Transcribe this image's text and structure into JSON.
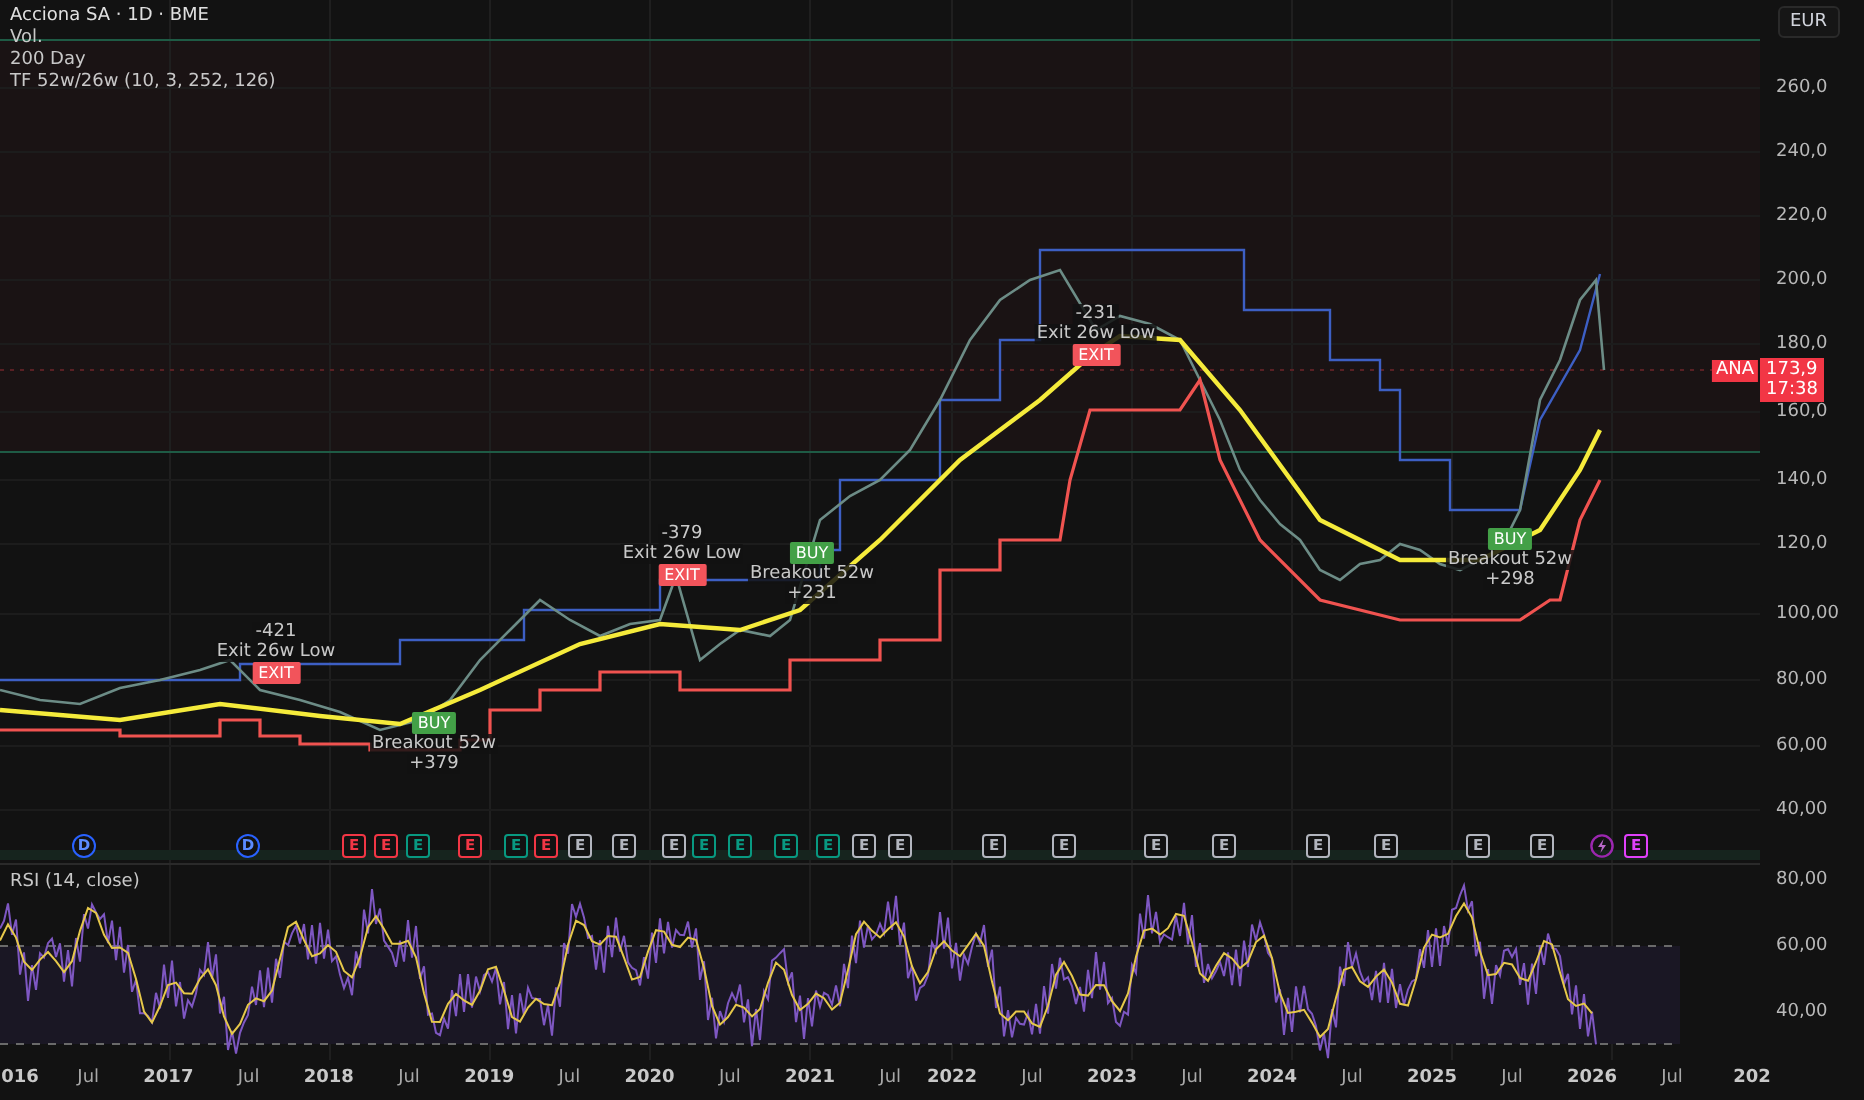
{
  "legend": {
    "symbol": "Acciona SA · 1D · BME",
    "indicators": [
      "Vol.",
      "200 Day",
      "TF 52w/26w (10, 3, 252, 126)"
    ]
  },
  "currency": "EUR",
  "price_axis": [
    "260,0",
    "240,0",
    "220,0",
    "200,0",
    "180,0",
    "160,0",
    "140,0",
    "120,0",
    "100,00",
    "80,00",
    "60,00",
    "40,00"
  ],
  "last_price": {
    "ticker": "ANA",
    "price": "173,9",
    "countdown": "17:38"
  },
  "signals": [
    {
      "kind": "exit",
      "badge": "EXIT",
      "label": "Exit 26w Low",
      "result": "-421"
    },
    {
      "kind": "buy",
      "badge": "BUY",
      "label": "Breakout 52w",
      "result": "+379"
    },
    {
      "kind": "exit",
      "badge": "EXIT",
      "label": "Exit 26w Low",
      "result": "-379"
    },
    {
      "kind": "buy",
      "badge": "BUY",
      "label": "Breakout 52w",
      "result": "+231"
    },
    {
      "kind": "exit",
      "badge": "EXIT",
      "label": "Exit 26w Low",
      "result": "-231"
    },
    {
      "kind": "buy",
      "badge": "BUY",
      "label": "Breakout 52w",
      "result": "+298"
    }
  ],
  "events": [
    {
      "kind": "dividend",
      "text": "D"
    },
    {
      "kind": "dividend",
      "text": "D"
    },
    {
      "kind": "earnings",
      "text": "E",
      "color": "#f23645"
    },
    {
      "kind": "earnings",
      "text": "E",
      "color": "#f23645"
    },
    {
      "kind": "earnings",
      "text": "E",
      "color": "#089981"
    },
    {
      "kind": "earnings",
      "text": "E",
      "color": "#f23645"
    },
    {
      "kind": "earnings",
      "text": "E",
      "color": "#089981"
    },
    {
      "kind": "earnings",
      "text": "E",
      "color": "#f23645"
    },
    {
      "kind": "earnings",
      "text": "E",
      "color": "#b2b5be"
    },
    {
      "kind": "earnings",
      "text": "E",
      "color": "#b2b5be"
    },
    {
      "kind": "earnings",
      "text": "E",
      "color": "#b2b5be"
    },
    {
      "kind": "earnings",
      "text": "E",
      "color": "#089981"
    },
    {
      "kind": "earnings",
      "text": "E",
      "color": "#089981"
    },
    {
      "kind": "earnings",
      "text": "E",
      "color": "#089981"
    },
    {
      "kind": "earnings",
      "text": "E",
      "color": "#089981"
    },
    {
      "kind": "earnings",
      "text": "E",
      "color": "#b2b5be"
    },
    {
      "kind": "earnings",
      "text": "E",
      "color": "#b2b5be"
    },
    {
      "kind": "earnings",
      "text": "E",
      "color": "#b2b5be"
    },
    {
      "kind": "earnings",
      "text": "E",
      "color": "#b2b5be"
    },
    {
      "kind": "earnings",
      "text": "E",
      "color": "#b2b5be"
    },
    {
      "kind": "earnings",
      "text": "E",
      "color": "#b2b5be"
    },
    {
      "kind": "earnings",
      "text": "E",
      "color": "#b2b5be"
    },
    {
      "kind": "earnings",
      "text": "E",
      "color": "#b2b5be"
    },
    {
      "kind": "earnings",
      "text": "E",
      "color": "#b2b5be"
    },
    {
      "kind": "earnings",
      "text": "E",
      "color": "#b2b5be"
    },
    {
      "kind": "split"
    },
    {
      "kind": "earnings",
      "text": "E",
      "color": "#e040fb"
    }
  ],
  "rsi": {
    "title": "RSI (14, close)",
    "axis": [
      "80,00",
      "60,00",
      "40,00"
    ]
  },
  "time_axis": [
    {
      "label": "016",
      "kind": "year"
    },
    {
      "label": "Jul",
      "kind": "month"
    },
    {
      "label": "2017",
      "kind": "year"
    },
    {
      "label": "Jul",
      "kind": "month"
    },
    {
      "label": "2018",
      "kind": "year"
    },
    {
      "label": "Jul",
      "kind": "month"
    },
    {
      "label": "2019",
      "kind": "year"
    },
    {
      "label": "Jul",
      "kind": "month"
    },
    {
      "label": "2020",
      "kind": "year"
    },
    {
      "label": "Jul",
      "kind": "month"
    },
    {
      "label": "2021",
      "kind": "year"
    },
    {
      "label": "Jul",
      "kind": "month"
    },
    {
      "label": "2022",
      "kind": "year"
    },
    {
      "label": "Jul",
      "kind": "month"
    },
    {
      "label": "2023",
      "kind": "year"
    },
    {
      "label": "Jul",
      "kind": "month"
    },
    {
      "label": "2024",
      "kind": "year"
    },
    {
      "label": "Jul",
      "kind": "month"
    },
    {
      "label": "2025",
      "kind": "year"
    },
    {
      "label": "Jul",
      "kind": "month"
    },
    {
      "label": "2026",
      "kind": "year"
    },
    {
      "label": "Jul",
      "kind": "month"
    },
    {
      "label": "202",
      "kind": "year"
    }
  ]
}
